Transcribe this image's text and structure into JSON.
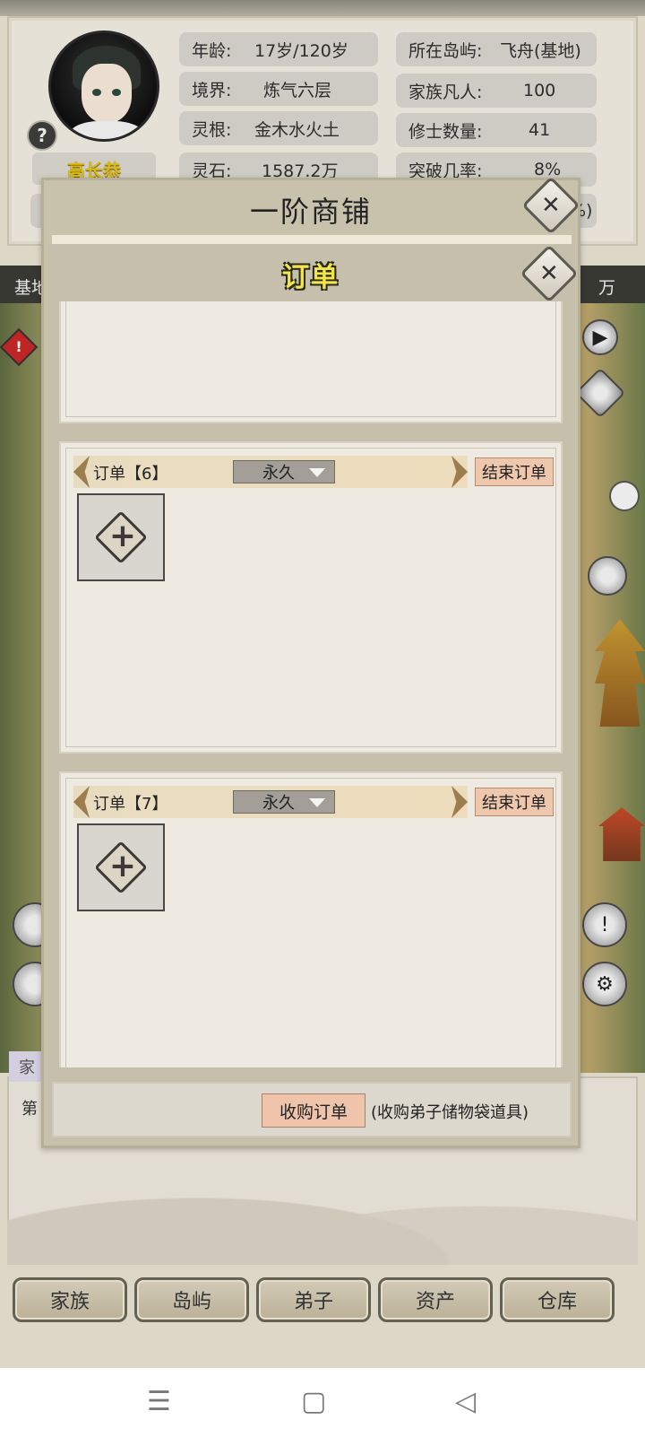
{
  "profile": {
    "name": "高长恭",
    "help": "?"
  },
  "stats": {
    "age_label": "年龄:",
    "age_value": "17岁/120岁",
    "realm_label": "境界:",
    "realm_value": "炼气六层",
    "root_label": "灵根:",
    "root_value": "金木水火土",
    "stone_label": "灵石:",
    "stone_value": "1587.2万",
    "island_label": "所在岛屿:",
    "island_value": "飞舟(基地)",
    "mortals_label": "家族凡人:",
    "mortals_value": "100",
    "cultivators_label": "修士数量:",
    "cultivators_value": "41",
    "breakthrough_label": "突破几率:",
    "breakthrough_value": "8%",
    "partial_right": "%)"
  },
  "map": {
    "top_left": "基地",
    "top_right": "万",
    "alert": "!"
  },
  "shop": {
    "title": "一阶商铺",
    "close": "✕"
  },
  "orders": {
    "title": "订单",
    "close": "✕",
    "items": [
      {
        "label": "订单【6】",
        "duration": "永久",
        "end": "结束订单",
        "add": "+"
      },
      {
        "label": "订单【7】",
        "duration": "永久",
        "end": "结束订单",
        "add": "+"
      }
    ],
    "buy_button": "收购订单",
    "buy_note": "(收购弟子储物袋道具)"
  },
  "lower": {
    "tab": "家",
    "text": "第"
  },
  "nav": {
    "family": "家族",
    "island": "岛屿",
    "disciple": "弟子",
    "assets": "资产",
    "warehouse": "仓库"
  },
  "system_nav": {
    "menu": "☰",
    "home": "▢",
    "back": "◁"
  }
}
